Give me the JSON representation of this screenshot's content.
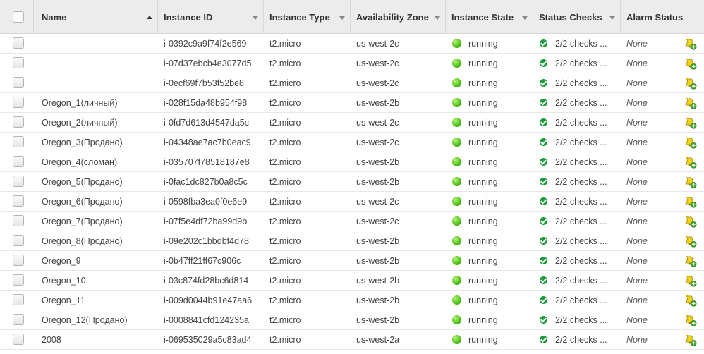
{
  "header": {
    "name": "Name",
    "instance_id": "Instance ID",
    "instance_type": "Instance Type",
    "availability_zone": "Availability Zone",
    "instance_state": "Instance State",
    "status_checks": "Status Checks",
    "alarm_status": "Alarm Status"
  },
  "colors": {
    "running": "#52c41a",
    "checks_passed": "#1c9c3b",
    "header_bg": "#ececec"
  },
  "icons": {
    "sort_asc": "sort-ascending-icon",
    "filter": "chevron-down-icon",
    "alarm_add": "add-alarm-icon"
  },
  "rows": [
    {
      "name": "",
      "id": "i-0392c9a9f74f2e569",
      "type": "t2.micro",
      "zone": "us-west-2c",
      "state": "running",
      "checks": "2/2 checks ...",
      "alarm": "None"
    },
    {
      "name": "",
      "id": "i-07d37ebcb4e3077d5",
      "type": "t2.micro",
      "zone": "us-west-2c",
      "state": "running",
      "checks": "2/2 checks ...",
      "alarm": "None"
    },
    {
      "name": "",
      "id": "i-0ecf69f7b53f52be8",
      "type": "t2.micro",
      "zone": "us-west-2c",
      "state": "running",
      "checks": "2/2 checks ...",
      "alarm": "None"
    },
    {
      "name": "Oregon_1(личный)",
      "id": "i-028f15da48b954f98",
      "type": "t2.micro",
      "zone": "us-west-2b",
      "state": "running",
      "checks": "2/2 checks ...",
      "alarm": "None"
    },
    {
      "name": "Oregon_2(личный)",
      "id": "i-0fd7d613d4547da5c",
      "type": "t2.micro",
      "zone": "us-west-2c",
      "state": "running",
      "checks": "2/2 checks ...",
      "alarm": "None"
    },
    {
      "name": "Oregon_3(Продано)",
      "id": "i-04348ae7ac7b0eac9",
      "type": "t2.micro",
      "zone": "us-west-2c",
      "state": "running",
      "checks": "2/2 checks ...",
      "alarm": "None"
    },
    {
      "name": "Oregon_4(сломан)",
      "id": "i-035707f78518187e8",
      "type": "t2.micro",
      "zone": "us-west-2b",
      "state": "running",
      "checks": "2/2 checks ...",
      "alarm": "None"
    },
    {
      "name": "Oregon_5(Продано)",
      "id": "i-0fac1dc827b0a8c5c",
      "type": "t2.micro",
      "zone": "us-west-2b",
      "state": "running",
      "checks": "2/2 checks ...",
      "alarm": "None"
    },
    {
      "name": "Oregon_6(Продано)",
      "id": "i-0598fba3ea0f0e6e9",
      "type": "t2.micro",
      "zone": "us-west-2c",
      "state": "running",
      "checks": "2/2 checks ...",
      "alarm": "None"
    },
    {
      "name": "Oregon_7(Продано)",
      "id": "i-07f5e4df72ba99d9b",
      "type": "t2.micro",
      "zone": "us-west-2c",
      "state": "running",
      "checks": "2/2 checks ...",
      "alarm": "None"
    },
    {
      "name": "Oregon_8(Продано)",
      "id": "i-09e202c1bbdbf4d78",
      "type": "t2.micro",
      "zone": "us-west-2b",
      "state": "running",
      "checks": "2/2 checks ...",
      "alarm": "None"
    },
    {
      "name": "Oregon_9",
      "id": "i-0b47ff21ff67c906c",
      "type": "t2.micro",
      "zone": "us-west-2b",
      "state": "running",
      "checks": "2/2 checks ...",
      "alarm": "None"
    },
    {
      "name": "Oregon_10",
      "id": "i-03c874fd28bc6d814",
      "type": "t2.micro",
      "zone": "us-west-2b",
      "state": "running",
      "checks": "2/2 checks ...",
      "alarm": "None"
    },
    {
      "name": "Oregon_11",
      "id": "i-009d0044b91e47aa6",
      "type": "t2.micro",
      "zone": "us-west-2b",
      "state": "running",
      "checks": "2/2 checks ...",
      "alarm": "None"
    },
    {
      "name": "Oregon_12(Продано)",
      "id": "i-0008841cfd124235a",
      "type": "t2.micro",
      "zone": "us-west-2b",
      "state": "running",
      "checks": "2/2 checks ...",
      "alarm": "None"
    },
    {
      "name": "2008",
      "id": "i-069535029a5c83ad4",
      "type": "t2.micro",
      "zone": "us-west-2a",
      "state": "running",
      "checks": "2/2 checks ...",
      "alarm": "None"
    }
  ]
}
